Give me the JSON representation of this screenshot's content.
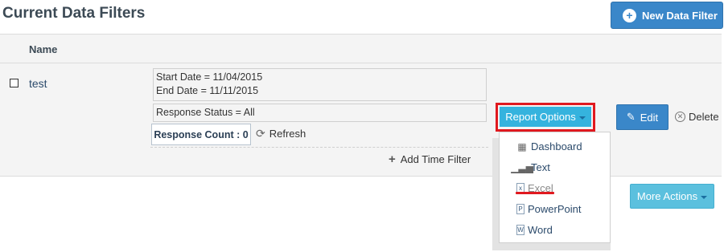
{
  "page_title": "Current Data Filters",
  "new_filter_button": "New Data Filter",
  "table": {
    "header_name": "Name",
    "row": {
      "name": "test",
      "start_date": "Start Date = 11/04/2015",
      "end_date": "End Date = 11/11/2015",
      "status": "Response Status = All",
      "response_count": "Response Count : 0",
      "refresh": "Refresh",
      "add_time_filter": "Add Time Filter"
    }
  },
  "report_options": {
    "label": "Report Options",
    "items": [
      {
        "label": "Dashboard",
        "icon": "table-icon"
      },
      {
        "label": "Text",
        "icon": "bar-chart-icon"
      },
      {
        "label": "Excel",
        "icon": "excel-icon"
      },
      {
        "label": "PowerPoint",
        "icon": "powerpoint-icon"
      },
      {
        "label": "Word",
        "icon": "word-icon"
      }
    ]
  },
  "edit_button": "Edit",
  "delete_button": "Delete",
  "more_actions_button": "More Actions",
  "colors": {
    "primary": "#3a87c9",
    "info": "#35b3de",
    "highlight": "#e0191f"
  }
}
